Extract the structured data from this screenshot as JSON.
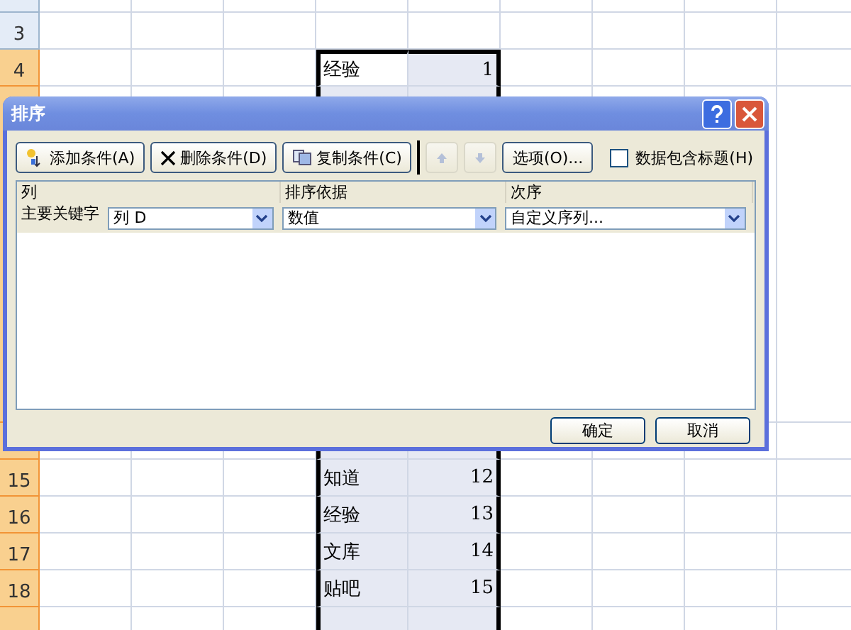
{
  "sheet": {
    "rows_top": [
      {
        "label": "3",
        "selected": false
      },
      {
        "label": "4",
        "selected": true,
        "text": "经验",
        "value": "1",
        "active": true
      }
    ],
    "rows_bottom": [
      {
        "label": "15",
        "selected": true,
        "text": "知道",
        "value": "12",
        "active": false
      },
      {
        "label": "16",
        "selected": true,
        "text": "经验",
        "value": "13",
        "active": false
      },
      {
        "label": "17",
        "selected": true,
        "text": "文库",
        "value": "14",
        "active": false
      },
      {
        "label": "18",
        "selected": true,
        "text": "贴吧",
        "value": "15",
        "active": false
      }
    ]
  },
  "dialog": {
    "title": "排序",
    "toolbar": [
      {
        "kind": "add",
        "label": "添加条件(A)",
        "disabled": false
      },
      {
        "kind": "delete",
        "label": "删除条件(D)",
        "disabled": false
      },
      {
        "kind": "copy",
        "label": "复制条件(C)",
        "disabled": false
      },
      {
        "kind": "up",
        "disabled": true
      },
      {
        "kind": "down",
        "disabled": true
      },
      {
        "kind": "text",
        "label": "选项(O)...",
        "disabled": false
      }
    ],
    "header_checkbox": {
      "label": "数据包含标题(H)",
      "checked": false
    },
    "columns": [
      "列",
      "排序依据",
      "次序"
    ],
    "levels": [
      {
        "label": "主要关键字",
        "column": "列 D",
        "sort_on": "数值",
        "order": "自定义序列..."
      }
    ],
    "buttons": [
      "确定",
      "取消"
    ]
  }
}
